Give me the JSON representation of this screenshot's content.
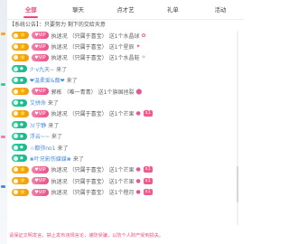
{
  "tabs": [
    {
      "label": "全部",
      "active": true
    },
    {
      "label": "聊天",
      "active": false
    },
    {
      "label": "点才艺",
      "active": false
    },
    {
      "label": "礼单",
      "active": false
    },
    {
      "label": "活动",
      "active": false
    }
  ],
  "notice": "【系统公告】：只要努力 剩下的交给天意",
  "messages": [
    {
      "level": "⭐",
      "level_color": "gold",
      "fan": "♥VIP",
      "name": "执迷况",
      "name_blue": false,
      "sub": "（只属于喜宝）",
      "text": "送1个水晶球",
      "gift_icon": "✿",
      "gift_icon_name": "crystal-ball-icon",
      "tag": ""
    },
    {
      "level": "⭐",
      "level_color": "gold",
      "fan": "♥VIP",
      "name": "执迷况",
      "name_blue": false,
      "sub": "（只属于喜宝）",
      "text": "送1个星辰",
      "gift_icon": "✦",
      "gift_icon_name": "star-gift-icon",
      "tag": ""
    },
    {
      "level": "⭐",
      "level_color": "gold",
      "fan": "♥VIP",
      "name": "执迷况",
      "name_blue": false,
      "sub": "（只属于喜宝）",
      "text": "送1个水晶鞋",
      "gift_icon": "✧",
      "gift_icon_name": "crystal-shoe-icon",
      "tag": ""
    },
    {
      "level": "◆",
      "level_color": "green",
      "fan": "",
      "name": "ℱ·v九天~",
      "name_blue": true,
      "sub": "",
      "text": "来了",
      "gift_icon": "",
      "gift_icon_name": "",
      "tag": ""
    },
    {
      "level": "◆",
      "level_color": "green",
      "fan": "",
      "name": "❤温柔爱&靓❤",
      "name_blue": true,
      "sub": "",
      "text": "来了",
      "gift_icon": "",
      "gift_icon_name": "",
      "tag": ""
    },
    {
      "level": "⭐",
      "level_color": "gold",
      "fan": "♥VIP",
      "name": "郭栋",
      "name_blue": false,
      "sub": "（唯一青青）",
      "text": "送1个旗国拯裂",
      "gift_icon": "⬤",
      "gift_icon_name": "bag-gift-icon",
      "tag": ""
    },
    {
      "level": "◆",
      "level_color": "green",
      "fan": "",
      "name": "艾拼命",
      "name_blue": true,
      "sub": "",
      "text": "来了",
      "gift_icon": "",
      "gift_icon_name": "",
      "tag": ""
    },
    {
      "level": "⭐",
      "level_color": "gold",
      "fan": "♥VIP",
      "name": "执迷况",
      "name_blue": false,
      "sub": "（只属于喜宝）",
      "text": "送1个芒果",
      "gift_icon": "●",
      "gift_icon_name": "mango-icon",
      "tag": "x1"
    },
    {
      "level": "◆",
      "level_color": "green",
      "fan": "",
      "name": "ℳ宁静",
      "name_blue": true,
      "sub": "",
      "text": "来了",
      "gift_icon": "",
      "gift_icon_name": "",
      "tag": ""
    },
    {
      "level": "◆",
      "level_color": "green",
      "fan": "",
      "name": "浮云~~",
      "name_blue": true,
      "sub": "",
      "text": "来了",
      "gift_icon": "",
      "gift_icon_name": "",
      "tag": ""
    },
    {
      "level": "◆",
      "level_color": "green",
      "fan": "",
      "name": "☆都弥no1",
      "name_blue": true,
      "sub": "",
      "text": "来了",
      "gift_icon": "",
      "gift_icon_name": "",
      "tag": ""
    },
    {
      "level": "◆",
      "level_color": "green",
      "fan": "",
      "name": "❀叶兄影伤媒媒❀",
      "name_blue": true,
      "sub": "",
      "text": "来了",
      "gift_icon": "",
      "gift_icon_name": "",
      "tag": ""
    },
    {
      "level": "⭐",
      "level_color": "gold",
      "fan": "♥VIP",
      "name": "执迷况",
      "name_blue": false,
      "sub": "（只属于喜宝）",
      "text": "送1个芒果",
      "gift_icon": "●",
      "gift_icon_name": "mango-icon",
      "tag": "x1"
    },
    {
      "level": "⭐",
      "level_color": "gold",
      "fan": "♥VIP",
      "name": "执迷况",
      "name_blue": false,
      "sub": "（只属于喜宝）",
      "text": "送1个芒果",
      "gift_icon": "●",
      "gift_icon_name": "mango-icon",
      "tag": "x1"
    },
    {
      "level": "⭐",
      "level_color": "gold",
      "fan": "♥VIP",
      "name": "执迷况",
      "name_blue": false,
      "sub": "（只属于喜宝）",
      "text": "送1个橙月",
      "gift_icon": "●",
      "gift_icon_name": "orange-moon-icon",
      "tag": "x1"
    }
  ],
  "footer": "请保证文明发言，禁止发布违规言论，谨防受骗，以防个人财产受到损失。",
  "colors": {
    "accent": "#f0457c",
    "gold_badge": "#f6b21c",
    "green_badge": "#1cb58a",
    "fan_badge": "#ee4f86"
  }
}
